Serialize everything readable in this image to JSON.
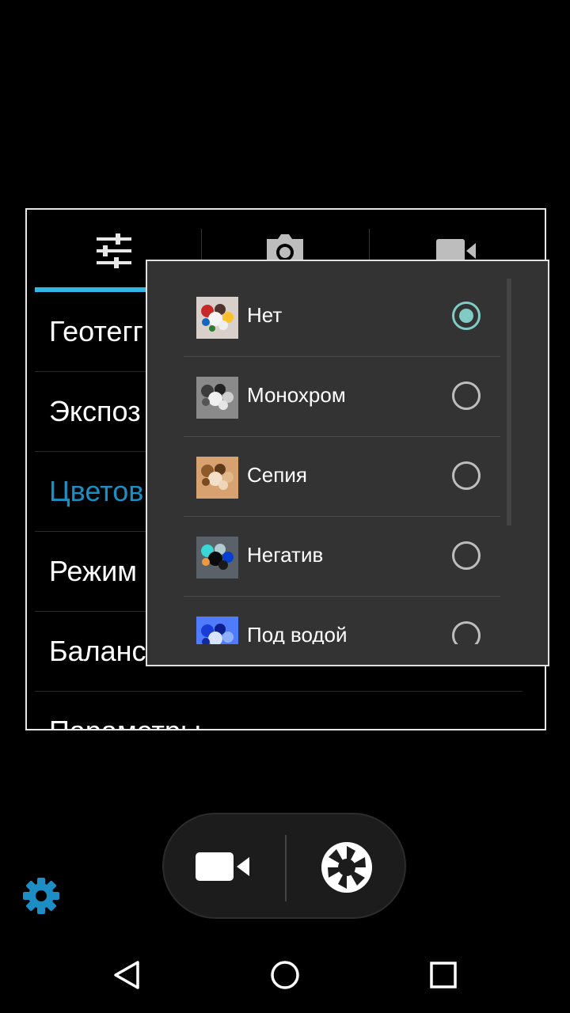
{
  "settings_panel": {
    "tabs": [
      {
        "name": "settings-sliders-icon"
      },
      {
        "name": "camera-icon"
      },
      {
        "name": "video-camera-icon"
      }
    ],
    "items": [
      {
        "label": "Геотегг"
      },
      {
        "label": "Экспоз"
      },
      {
        "label": "Цветов",
        "active": true
      },
      {
        "label": "Режим"
      },
      {
        "label": "Баланс"
      },
      {
        "label": "Параметры"
      }
    ]
  },
  "color_effects_popup": {
    "options": [
      {
        "label": "Нет",
        "selected": true
      },
      {
        "label": "Монохром",
        "selected": false
      },
      {
        "label": "Сепия",
        "selected": false
      },
      {
        "label": "Негатив",
        "selected": false
      },
      {
        "label": "Под водой",
        "selected": false
      }
    ]
  },
  "controls": {
    "video_icon": "video-camera-icon",
    "shutter_icon": "shutter-icon",
    "settings_icon": "gear-icon"
  },
  "navigation": {
    "back_icon": "back-triangle-icon",
    "home_icon": "home-circle-icon",
    "recents_icon": "recents-square-icon"
  },
  "colors": {
    "accent": "#33b5e5",
    "active_text": "#1c8ec4",
    "radio_checked": "#80cbc4",
    "popup_bg": "#333333"
  }
}
